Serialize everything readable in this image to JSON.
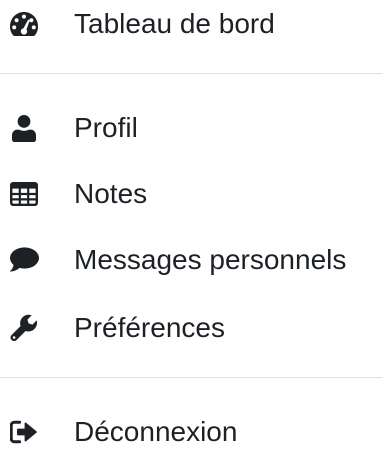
{
  "menu": {
    "items": [
      {
        "label": "Tableau de bord",
        "icon": "tachometer-icon"
      },
      {
        "label": "Profil",
        "icon": "user-icon"
      },
      {
        "label": "Notes",
        "icon": "table-icon"
      },
      {
        "label": "Messages personnels",
        "icon": "comment-icon"
      },
      {
        "label": "Préférences",
        "icon": "wrench-icon"
      },
      {
        "label": "Déconnexion",
        "icon": "sign-out-icon"
      }
    ]
  },
  "colors": {
    "text": "#1d2125",
    "divider": "#dee2e6",
    "background": "#ffffff"
  }
}
